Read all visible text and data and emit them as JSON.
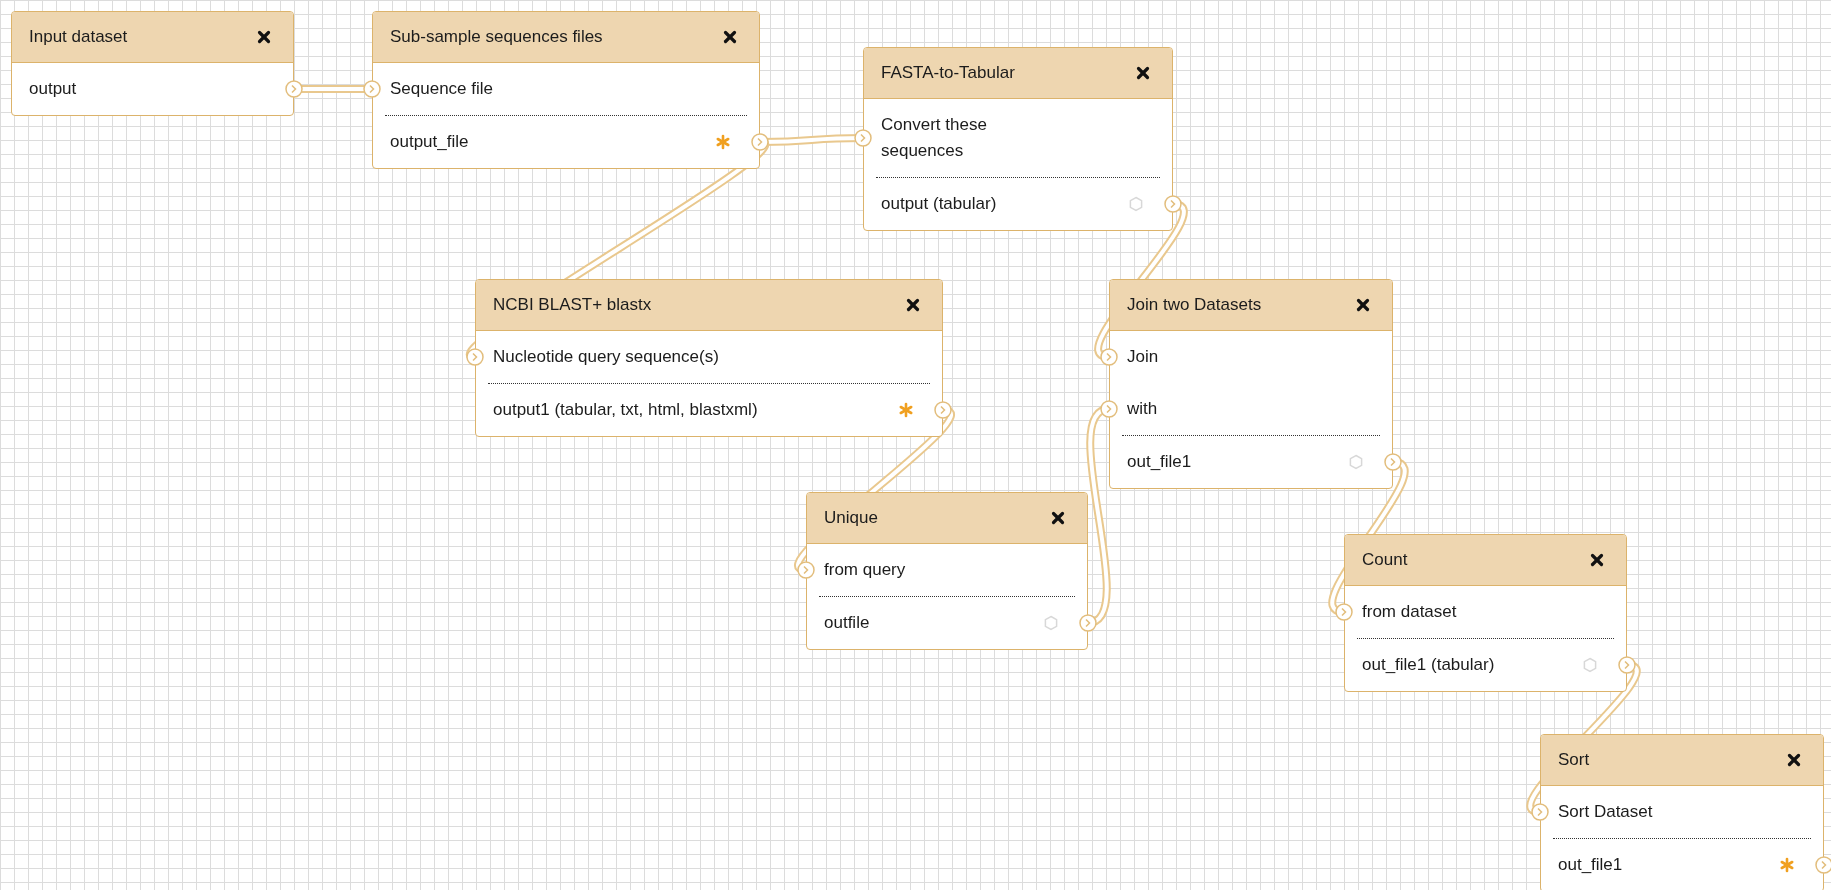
{
  "canvas": {
    "nodes": [
      {
        "kind": "input",
        "title": "Input dataset",
        "outputs": [
          {
            "label": "output"
          }
        ]
      },
      {
        "kind": "tool",
        "title": "Sub-sample sequences files",
        "inputs": [
          {
            "label": "Sequence file"
          }
        ],
        "outputs": [
          {
            "label": "output_file",
            "marked": true
          }
        ]
      },
      {
        "kind": "tool",
        "title": "FASTA-to-Tabular",
        "inputs": [
          {
            "label": "Convert these\nsequences"
          }
        ],
        "outputs": [
          {
            "label": "output (tabular)",
            "marked": false
          }
        ]
      },
      {
        "kind": "tool",
        "title": "NCBI BLAST+ blastx",
        "inputs": [
          {
            "label": "Nucleotide query sequence(s)"
          }
        ],
        "outputs": [
          {
            "label": "output1 (tabular, txt, html, blastxml)",
            "marked": true
          }
        ]
      },
      {
        "kind": "tool",
        "title": "Join two Datasets",
        "inputs": [
          {
            "label": "Join"
          },
          {
            "label": "with"
          }
        ],
        "outputs": [
          {
            "label": "out_file1",
            "marked": false
          }
        ]
      },
      {
        "kind": "tool",
        "title": "Unique",
        "inputs": [
          {
            "label": "from query"
          }
        ],
        "outputs": [
          {
            "label": "outfile",
            "marked": false
          }
        ]
      },
      {
        "kind": "tool",
        "title": "Count",
        "inputs": [
          {
            "label": "from dataset"
          }
        ],
        "outputs": [
          {
            "label": "out_file1 (tabular)",
            "marked": false
          }
        ]
      },
      {
        "kind": "tool",
        "title": "Sort",
        "inputs": [
          {
            "label": "Sort Dataset"
          }
        ],
        "outputs": [
          {
            "label": "out_file1",
            "marked": true
          }
        ]
      }
    ]
  }
}
